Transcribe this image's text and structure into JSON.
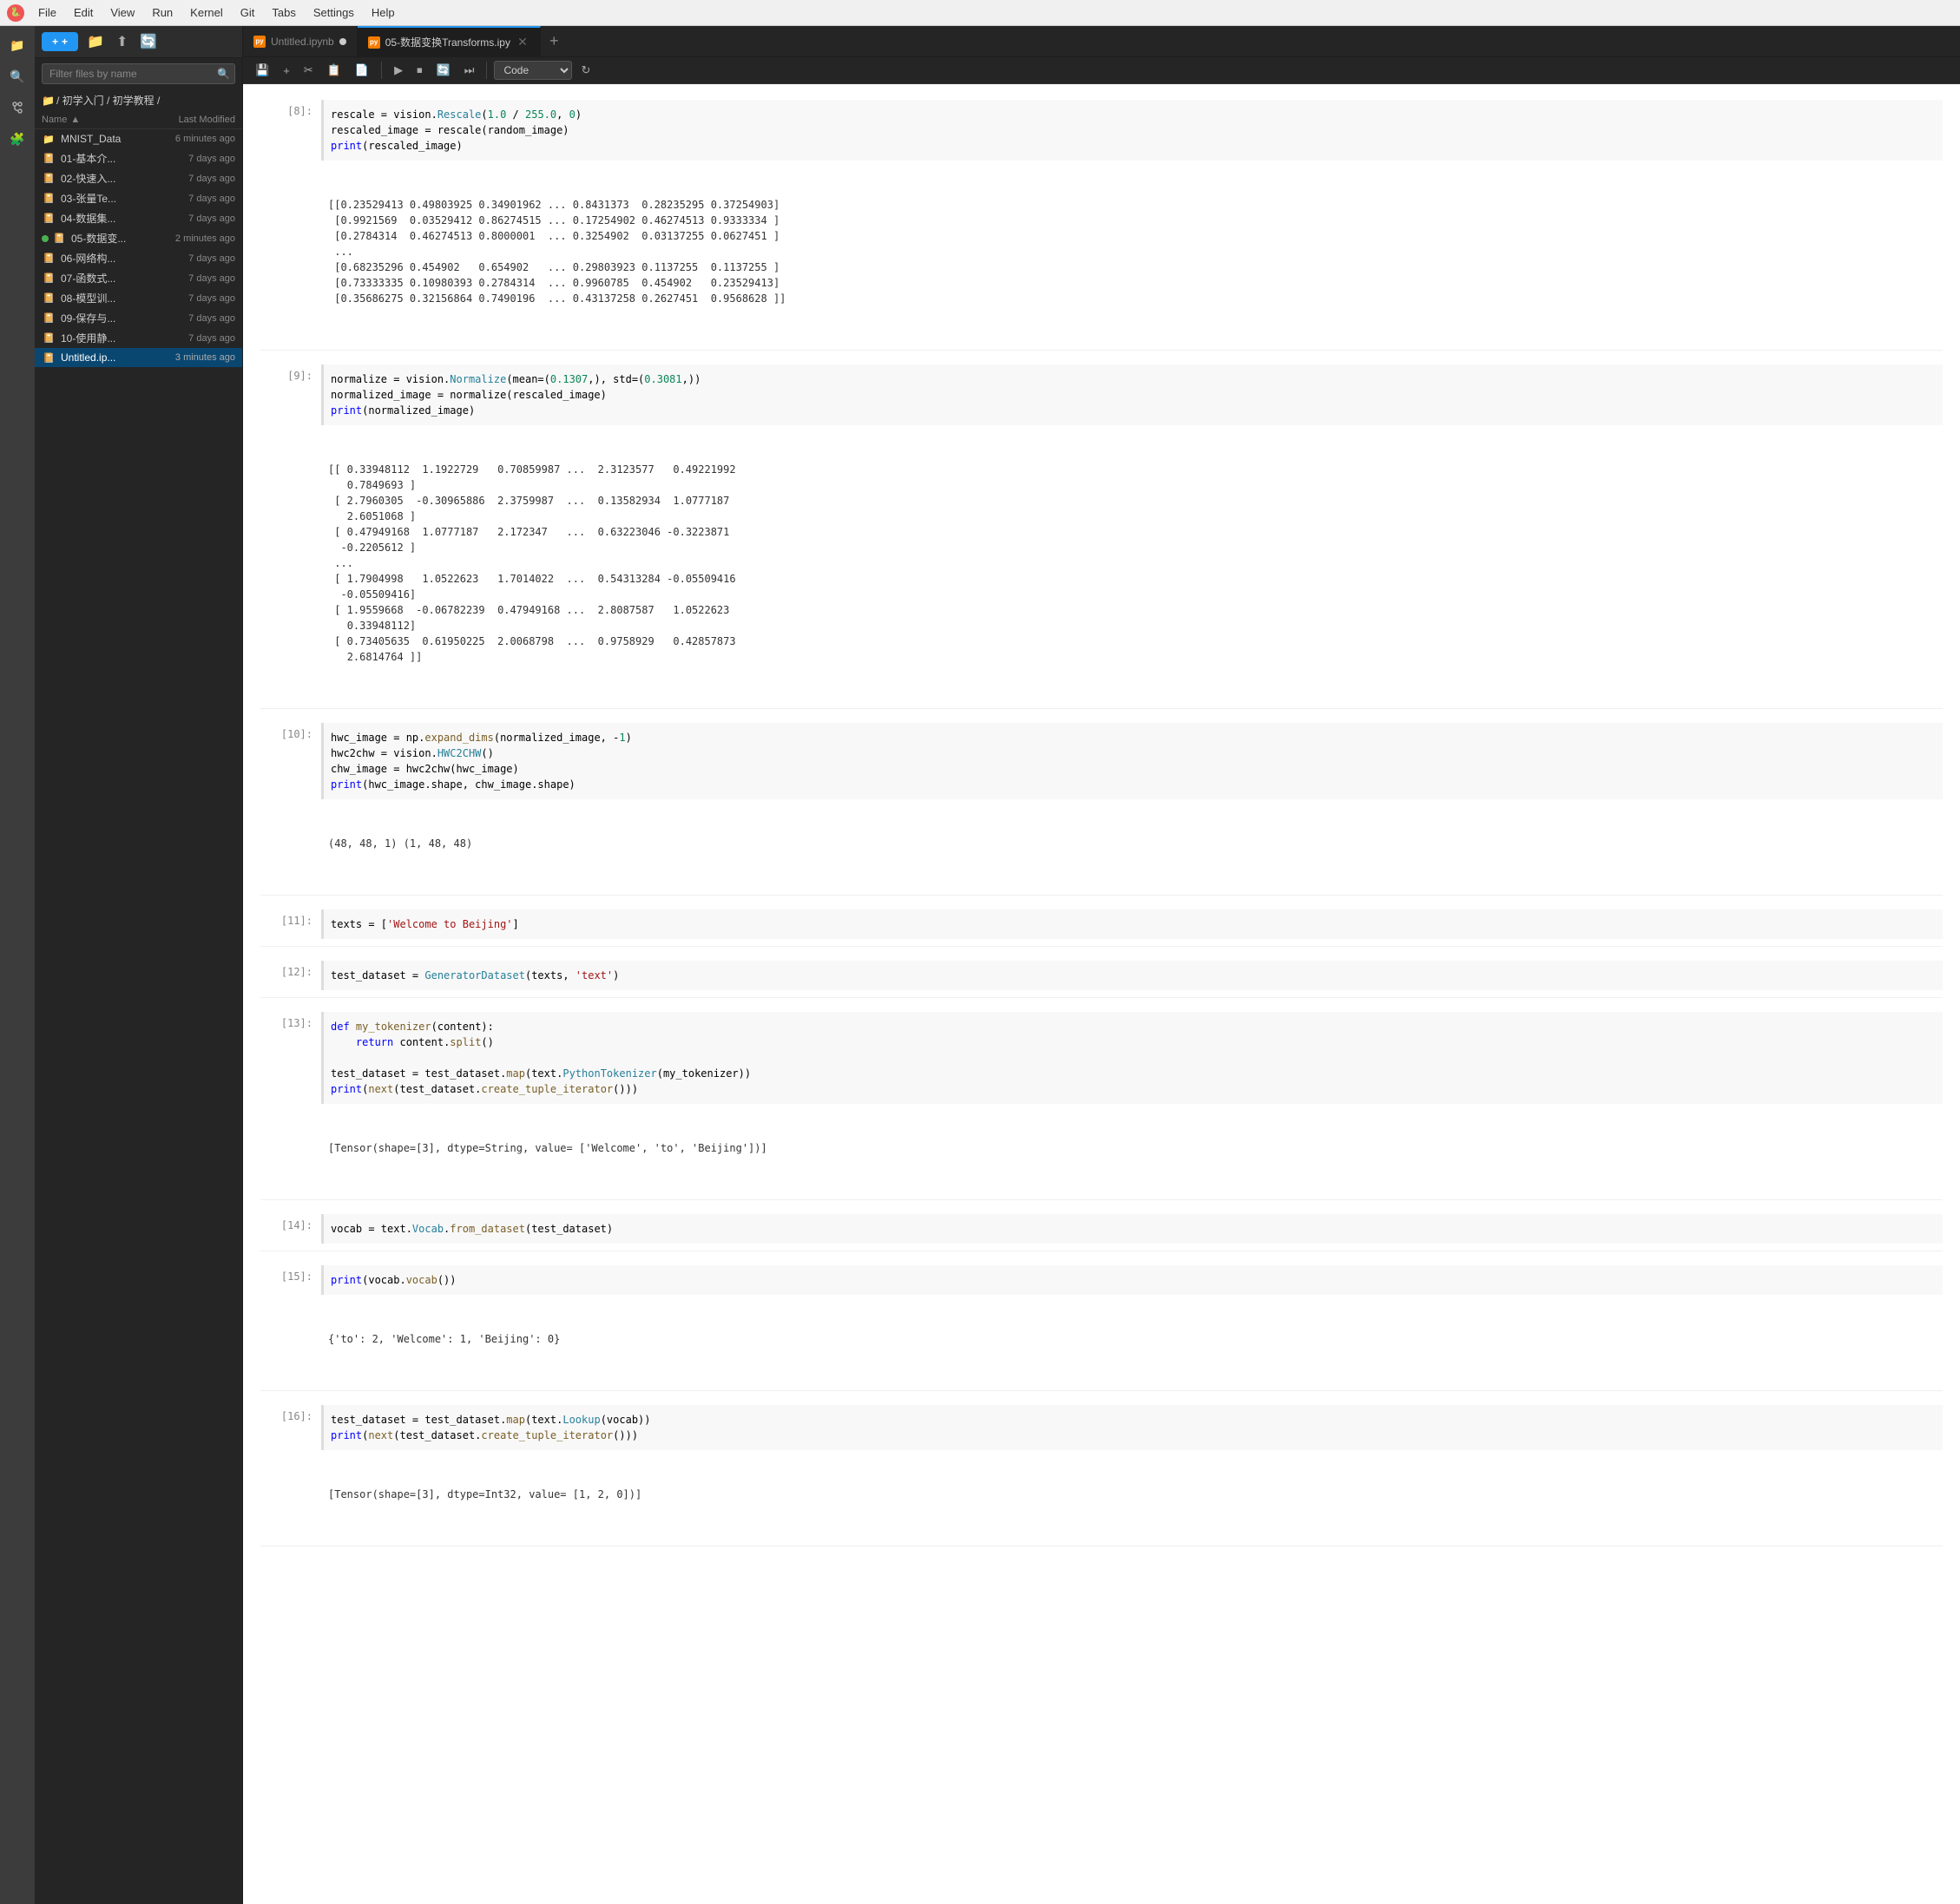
{
  "menubar": {
    "app": "🔴",
    "items": [
      "File",
      "Edit",
      "View",
      "Run",
      "Kernel",
      "Git",
      "Tabs",
      "Settings",
      "Help"
    ]
  },
  "sidebar_icons": [
    "➕",
    "📁",
    "🔍",
    "☰",
    "🧩"
  ],
  "file_panel": {
    "new_button": "+",
    "toolbar_icons": [
      "📁",
      "⬆",
      "🔄"
    ],
    "search_placeholder": "Filter files by name",
    "breadcrumb": [
      "📁",
      "/ 初学入门",
      "/ 初学教程",
      "/"
    ],
    "columns": {
      "name": "Name",
      "sort_icon": "▲",
      "modified": "Last Modified"
    },
    "files": [
      {
        "icon": "folder",
        "name": "MNIST_Data",
        "date": "6 minutes ago",
        "dot": false
      },
      {
        "icon": "notebook",
        "name": "01-基本介...",
        "date": "7 days ago",
        "dot": false
      },
      {
        "icon": "notebook",
        "name": "02-快速入...",
        "date": "7 days ago",
        "dot": false
      },
      {
        "icon": "notebook",
        "name": "03-张量Te...",
        "date": "7 days ago",
        "dot": false
      },
      {
        "icon": "notebook",
        "name": "04-数据集...",
        "date": "7 days ago",
        "dot": false
      },
      {
        "icon": "notebook-active",
        "name": "05-数据变...",
        "date": "2 minutes ago",
        "dot": true
      },
      {
        "icon": "notebook",
        "name": "06-网络构...",
        "date": "7 days ago",
        "dot": false
      },
      {
        "icon": "notebook",
        "name": "07-函数式...",
        "date": "7 days ago",
        "dot": false
      },
      {
        "icon": "notebook",
        "name": "08-模型训...",
        "date": "7 days ago",
        "dot": false
      },
      {
        "icon": "notebook",
        "name": "09-保存与...",
        "date": "7 days ago",
        "dot": false
      },
      {
        "icon": "notebook",
        "name": "10-使用静...",
        "date": "7 days ago",
        "dot": false
      },
      {
        "icon": "notebook",
        "name": "Untitled.ip...",
        "date": "3 minutes ago",
        "dot": false,
        "active": true
      }
    ]
  },
  "tabs": [
    {
      "label": "Untitled.ipynb",
      "active": false,
      "has_unsaved": true,
      "closeable": false
    },
    {
      "label": "05-数据变换Transforms.ipy",
      "active": true,
      "has_unsaved": false,
      "closeable": true
    }
  ],
  "notebook_toolbar": {
    "buttons": [
      "💾",
      "+",
      "✂",
      "📋",
      "📄",
      "▶",
      "⏹",
      "🔄",
      "⏭"
    ],
    "cell_type": "Code",
    "refresh_icon": "↻"
  },
  "cells": [
    {
      "number": "[8]:",
      "input": "rescale = vision.Rescale(1.0 / 255.0, 0)\nrescaled_image = rescale(random_image)\nprint(rescaled_image)",
      "output": "[[0.23529413 0.49803925 0.34901962 ... 0.8431373  0.28235295 0.37254903]\n [0.9921569  0.03529412 0.86274515 ... 0.17254902 0.46274513 0.9333334 ]\n [0.2784314  0.46274513 0.8000001  ... 0.3254902  0.03137255 0.0627451 ]\n ...\n [0.68235296 0.454902   0.654902   ... 0.29803923 0.1137255  0.1137255 ]\n [0.73333335 0.10980393 0.2784314  ... 0.9960785  0.454902   0.23529413]\n [0.35686275 0.32156864 0.7490196  ... 0.43137258 0.2627451  0.9568628 ]]"
    },
    {
      "number": "[9]:",
      "input": "normalize = vision.Normalize(mean=(0.1307,), std=(0.3081,))\nnormalized_image = normalize(rescaled_image)\nprint(normalized_image)",
      "output": "[[ 0.33948112  1.1922729   0.70859987 ...  2.3123577   0.49221992\n   0.7849693 ]\n [ 2.7960305  -0.30965886  2.3759987  ...  0.13582934  1.0777187\n   2.6051068 ]\n [ 0.47949168  1.0777187   2.172347   ...  0.63223046 -0.3223871\n  -0.2205612 ]\n ...\n [ 1.7904998   1.0522623   1.7014022  ...  0.54313284 -0.05509416\n  -0.05509416]\n [ 1.9559668  -0.06782239  0.47949168 ...  2.8087587   1.0522623\n   0.33948112]\n [ 0.73405635  0.61950225  2.0068798  ...  0.9758929   0.42857873\n   2.6814764 ]]"
    },
    {
      "number": "[10]:",
      "input": "hwc_image = np.expand_dims(normalized_image, -1)\nhwc2chw = vision.HWC2CHW()\nchw_image = hwc2chw(hwc_image)\nprint(hwc_image.shape, chw_image.shape)",
      "output": "(48, 48, 1) (1, 48, 48)"
    },
    {
      "number": "[11]:",
      "input": "texts = ['Welcome to Beijing']",
      "output": ""
    },
    {
      "number": "[12]:",
      "input": "test_dataset = GeneratorDataset(texts, 'text')",
      "output": ""
    },
    {
      "number": "[13]:",
      "input": "def my_tokenizer(content):\n    return content.split()\n\ntest_dataset = test_dataset.map(text.PythonTokenizer(my_tokenizer))\nprint(next(test_dataset.create_tuple_iterator()))",
      "output": "[Tensor(shape=[3], dtype=String, value= ['Welcome', 'to', 'Beijing'])]"
    },
    {
      "number": "[14]:",
      "input": "vocab = text.Vocab.from_dataset(test_dataset)",
      "output": ""
    },
    {
      "number": "[15]:",
      "input": "print(vocab.vocab())",
      "output": "{'to': 2, 'Welcome': 1, 'Beijing': 0}"
    },
    {
      "number": "[16]:",
      "input": "test_dataset = test_dataset.map(text.Lookup(vocab))\nprint(next(test_dataset.create_tuple_iterator()))",
      "output": "[Tensor(shape=[3], dtype=Int32, value= [1, 2, 0])]"
    }
  ]
}
